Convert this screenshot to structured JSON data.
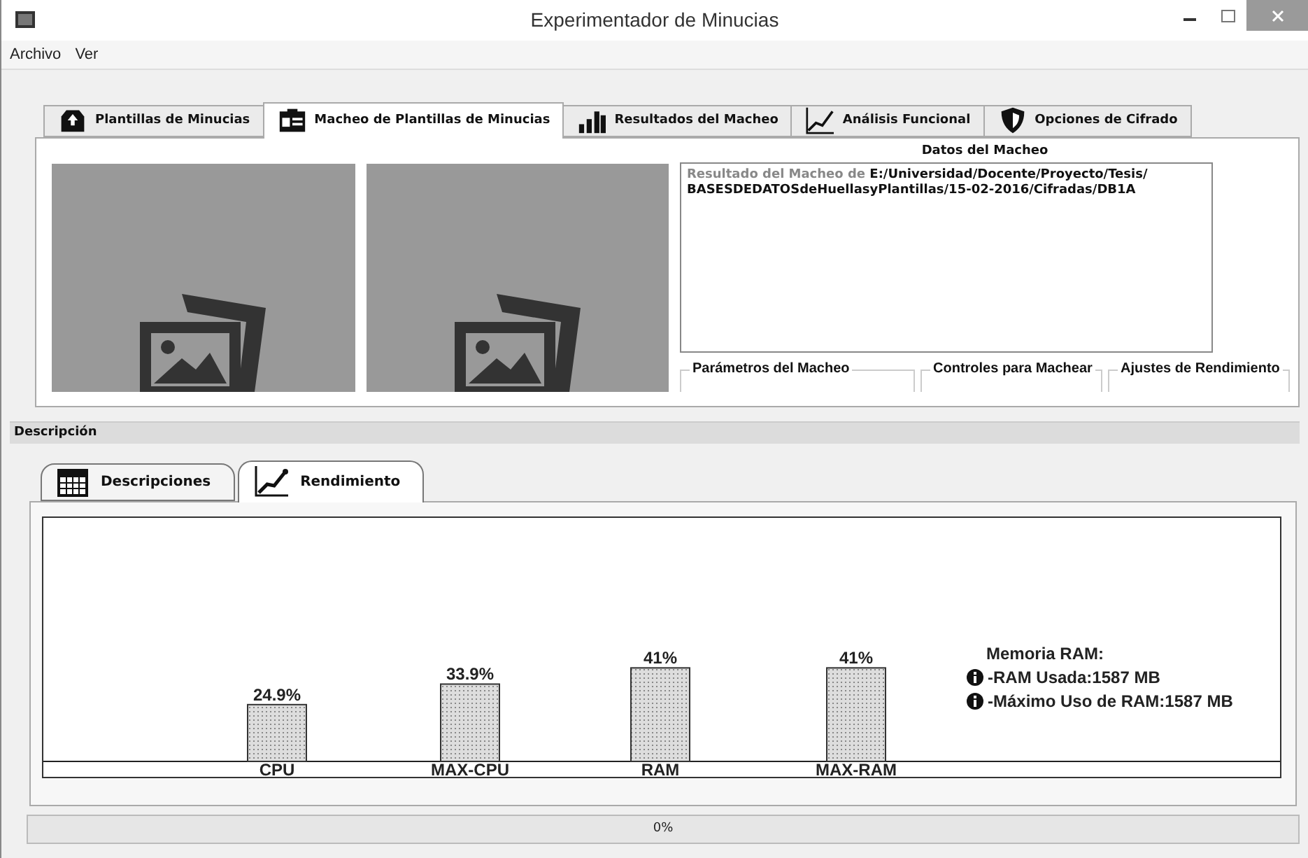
{
  "window": {
    "title": "Experimentador de Minucias"
  },
  "menu": [
    {
      "label": "Archivo"
    },
    {
      "label": "Ver"
    }
  ],
  "tabs": [
    {
      "label": "Plantillas de Minucias",
      "selected": false
    },
    {
      "label": "Macheo de Plantillas de Minucias",
      "selected": true
    },
    {
      "label": "Resultados del Macheo",
      "selected": false
    },
    {
      "label": "Análisis Funcional",
      "selected": false
    },
    {
      "label": "Opciones de Cifrado",
      "selected": false
    }
  ],
  "match_data": {
    "title": "Datos del Macheo",
    "result_label": "Resultado del Macheo de",
    "result_path": "E:/Universidad/Docente/Proyecto/Tesis/ BASESDEDATOSdeHuellasyPlantillas/15-02-2016/Cifradas/DB1A"
  },
  "groups": [
    {
      "label": "Parámetros del Macheo"
    },
    {
      "label": "Controles para Machear"
    },
    {
      "label": "Ajustes de Rendimiento"
    }
  ],
  "description": {
    "title": "Descripción",
    "tabs": [
      {
        "label": "Descripciones",
        "selected": false
      },
      {
        "label": "Rendimiento",
        "selected": true
      }
    ]
  },
  "chart_data": {
    "type": "bar",
    "categories": [
      "CPU",
      "MAX-CPU",
      "RAM",
      "MAX-RAM"
    ],
    "values": [
      24.9,
      33.9,
      41,
      41
    ],
    "value_labels": [
      "24.9%",
      "33.9%",
      "41%",
      "41%"
    ]
  },
  "legend": {
    "title": "Memoria RAM:",
    "items": [
      "-RAM Usada:1587 MB",
      "-Máximo Uso de RAM:1587 MB"
    ]
  },
  "progress": {
    "level": 0,
    "label": "0%"
  }
}
